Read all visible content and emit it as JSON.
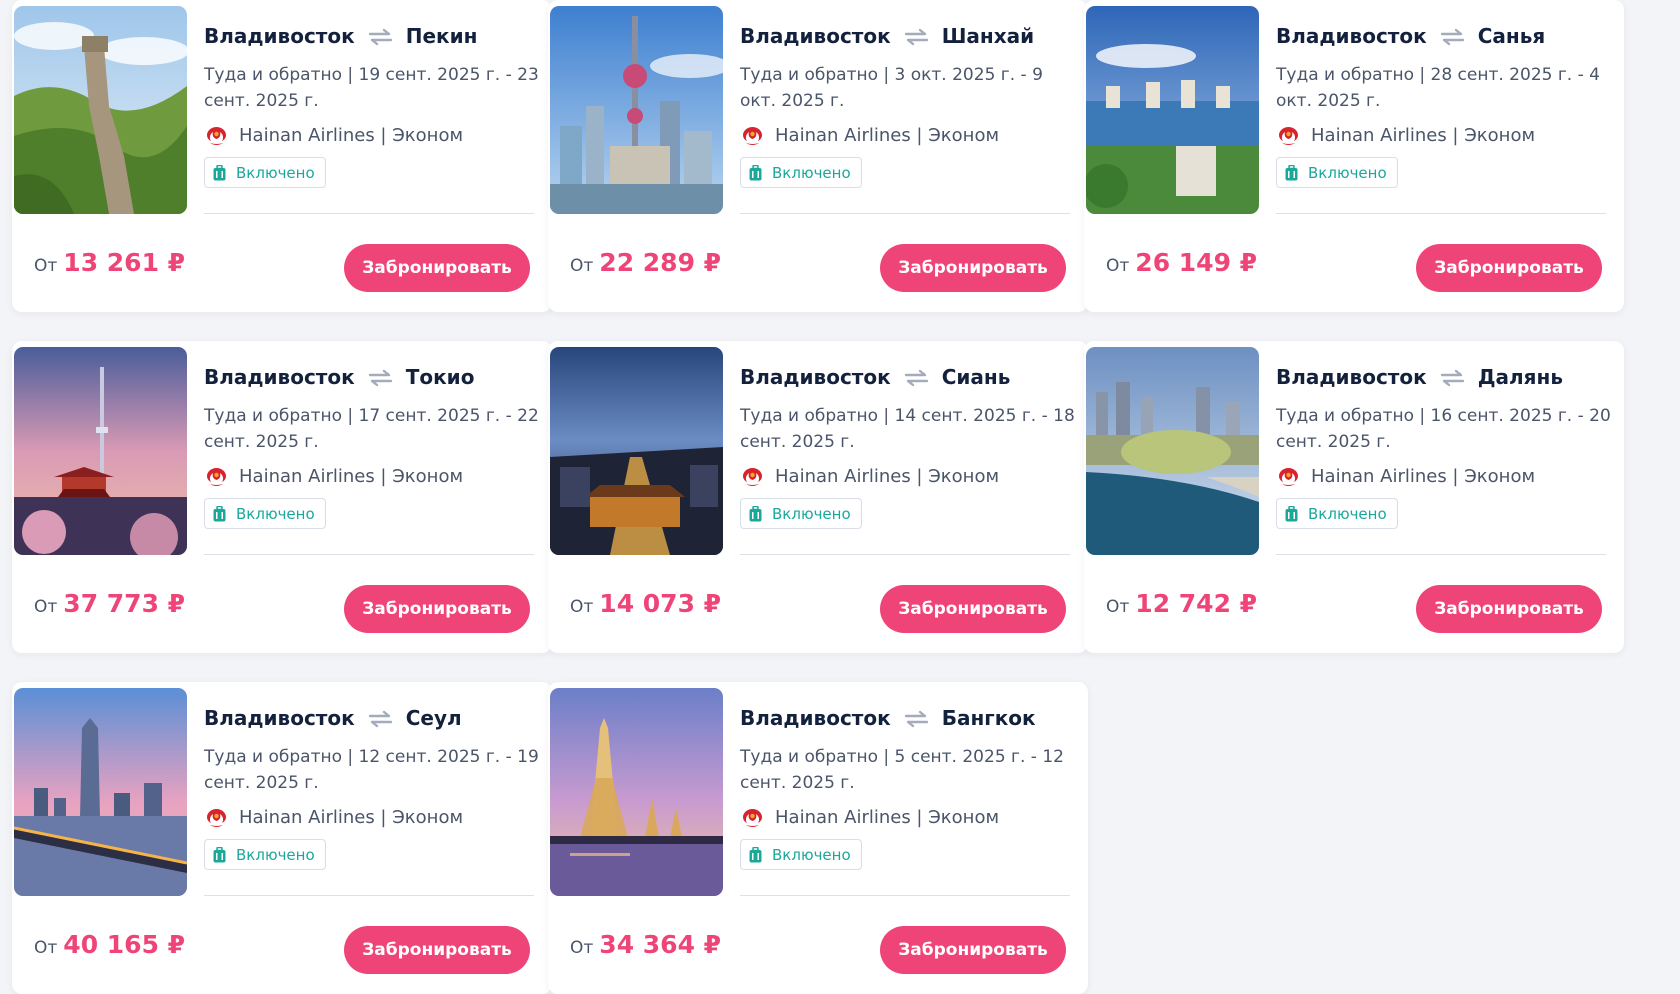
{
  "accent_color": "#ef4478",
  "included_color": "#1ba89a",
  "cards": [
    {
      "from": "Владивосток",
      "to": "Пекин",
      "dates": "Туда и обратно | 19 сент. 2025 г. - 23 сент. 2025 г.",
      "airline": "Hainan Airlines | Эконом",
      "baggage": "Включено",
      "price_prefix": "От",
      "price": "13 261 ₽",
      "button": "Забронировать",
      "photo": "great-wall"
    },
    {
      "from": "Владивосток",
      "to": "Шанхай",
      "dates": "Туда и обратно | 3 окт. 2025 г. - 9 окт. 2025 г.",
      "airline": "Hainan Airlines | Эконом",
      "baggage": "Включено",
      "price_prefix": "От",
      "price": "22 289 ₽",
      "button": "Забронировать",
      "photo": "shanghai-tower"
    },
    {
      "from": "Владивосток",
      "to": "Санья",
      "dates": "Туда и обратно | 28 сент. 2025 г. - 4 окт. 2025 г.",
      "airline": "Hainan Airlines | Эконом",
      "baggage": "Включено",
      "price_prefix": "От",
      "price": "26 149 ₽",
      "button": "Забронировать",
      "photo": "sanya-bay"
    },
    {
      "from": "Владивосток",
      "to": "Токио",
      "dates": "Туда и обратно | 17 сент. 2025 г. - 22 сент. 2025 г.",
      "airline": "Hainan Airlines | Эконом",
      "baggage": "Включено",
      "price_prefix": "От",
      "price": "37 773 ₽",
      "button": "Забронировать",
      "photo": "tokyo-skytree"
    },
    {
      "from": "Владивосток",
      "to": "Сиань",
      "dates": "Туда и обратно | 14 сент. 2025 г. - 18 сент. 2025 г.",
      "airline": "Hainan Airlines | Эконом",
      "baggage": "Включено",
      "price_prefix": "От",
      "price": "14 073 ₽",
      "button": "Забронировать",
      "photo": "xian-night"
    },
    {
      "from": "Владивосток",
      "to": "Далянь",
      "dates": "Туда и обратно | 16 сент. 2025 г. - 20 сент. 2025 г.",
      "airline": "Hainan Airlines | Эконом",
      "baggage": "Включено",
      "price_prefix": "От",
      "price": "12 742 ₽",
      "button": "Забронировать",
      "photo": "dalian-square"
    },
    {
      "from": "Владивосток",
      "to": "Сеул",
      "dates": "Туда и обратно | 12 сент. 2025 г. - 19 сент. 2025 г.",
      "airline": "Hainan Airlines | Эконом",
      "baggage": "Включено",
      "price_prefix": "От",
      "price": "40 165 ₽",
      "button": "Забронировать",
      "photo": "seoul-bridge"
    },
    {
      "from": "Владивосток",
      "to": "Бангкок",
      "dates": "Туда и обратно | 5 сент. 2025 г. - 12 сент. 2025 г.",
      "airline": "Hainan Airlines | Эконом",
      "baggage": "Включено",
      "price_prefix": "От",
      "price": "34 364 ₽",
      "button": "Забронировать",
      "photo": "bangkok-temple"
    }
  ]
}
